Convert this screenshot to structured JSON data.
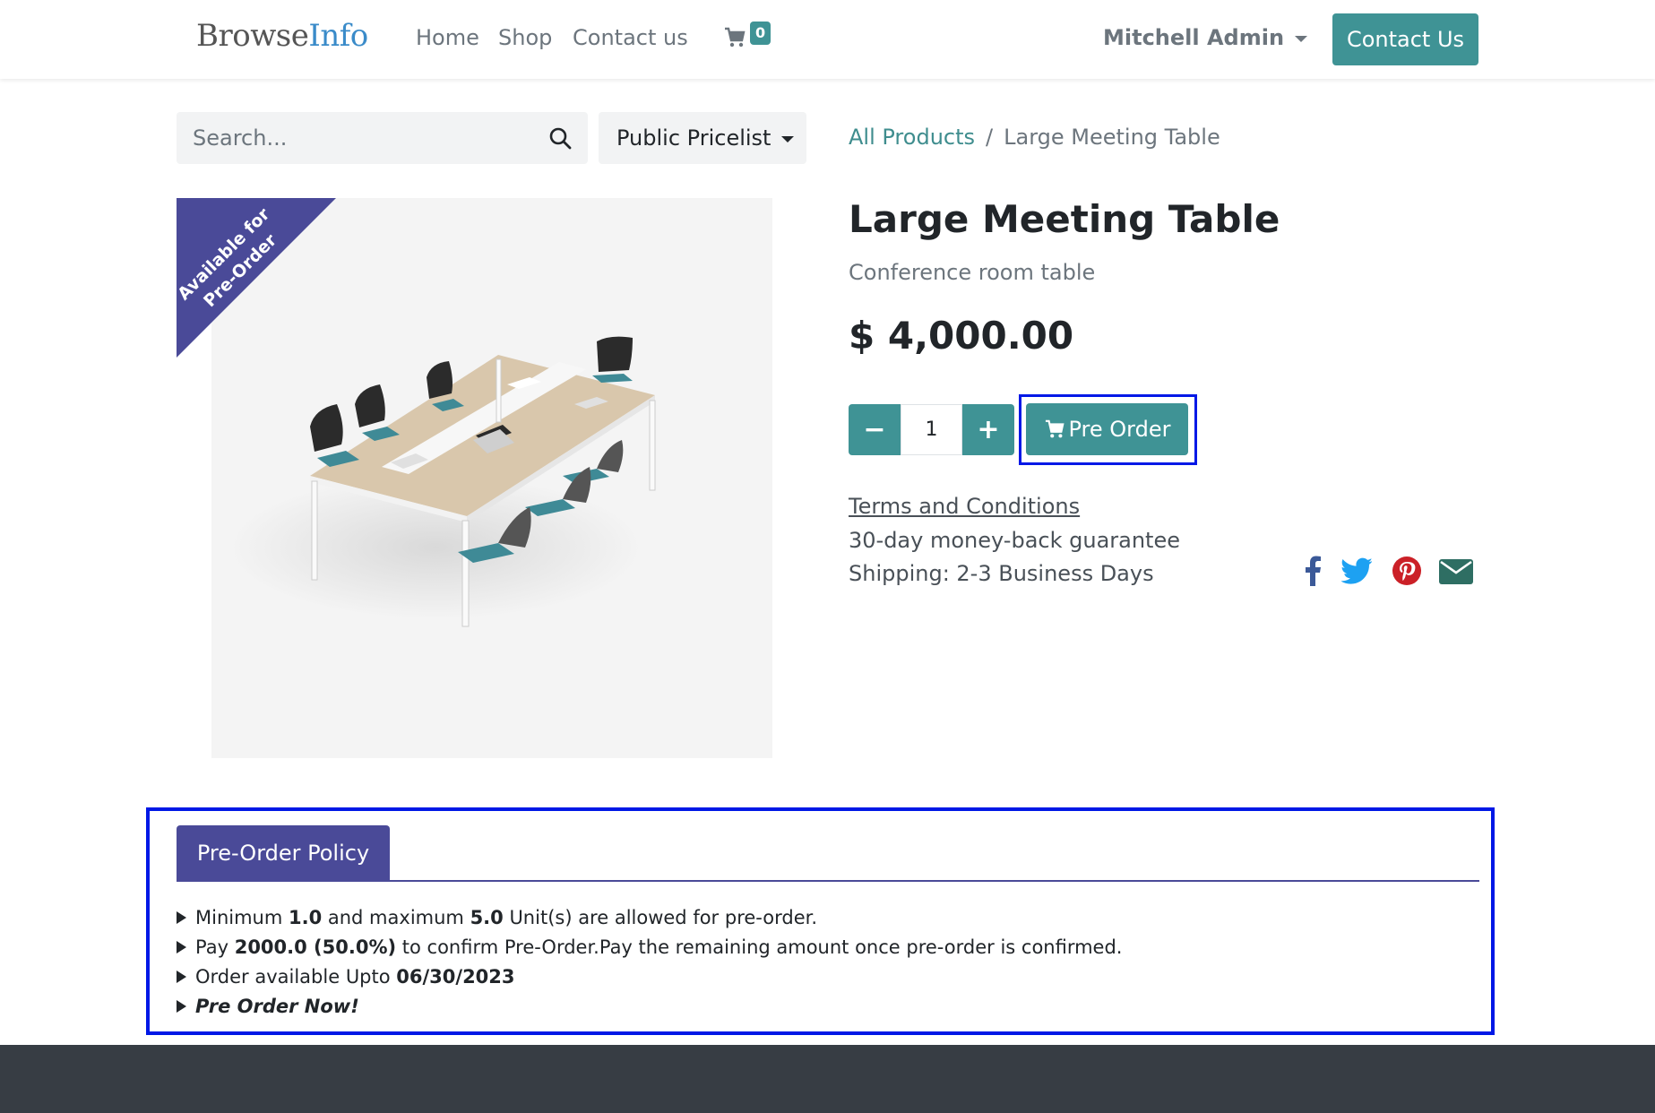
{
  "header": {
    "logo_part1": "Browse",
    "logo_part2": "Info",
    "nav": [
      "Home",
      "Shop",
      "Contact us"
    ],
    "cart_count": "0",
    "user_name": "Mitchell Admin",
    "contact_button": "Contact Us"
  },
  "search": {
    "placeholder": "Search...",
    "pricelist": "Public Pricelist"
  },
  "breadcrumb": {
    "parent": "All Products",
    "separator": "/",
    "current": "Large Meeting Table"
  },
  "product": {
    "ribbon_line1": "Available for",
    "ribbon_line2": "Pre-Order",
    "name": "Large Meeting Table",
    "description": "Conference room table",
    "price": "$ 4,000.00",
    "quantity": "1",
    "preorder_button": "Pre Order",
    "terms": "Terms and Conditions",
    "guarantee": "30-day money-back guarantee",
    "shipping": "Shipping: 2-3 Business Days"
  },
  "policy": {
    "tab_label": "Pre-Order Policy",
    "line1_a": "Minimum ",
    "line1_min": "1.0",
    "line1_b": " and maximum ",
    "line1_max": "5.0",
    "line1_c": " Unit(s) are allowed for pre-order.",
    "line2_a": "Pay ",
    "line2_amount": "2000.0 (50.0%)",
    "line2_b": " to confirm Pre-Order.Pay the remaining amount once pre-order is confirmed.",
    "line3_a": "Order available Upto ",
    "line3_date": "06/30/2023",
    "line4": "Pre Order Now!"
  },
  "colors": {
    "accent": "#3f9395",
    "ribbon": "#4a4a98",
    "highlight_frame": "#0018e6",
    "footer": "#373d44"
  }
}
